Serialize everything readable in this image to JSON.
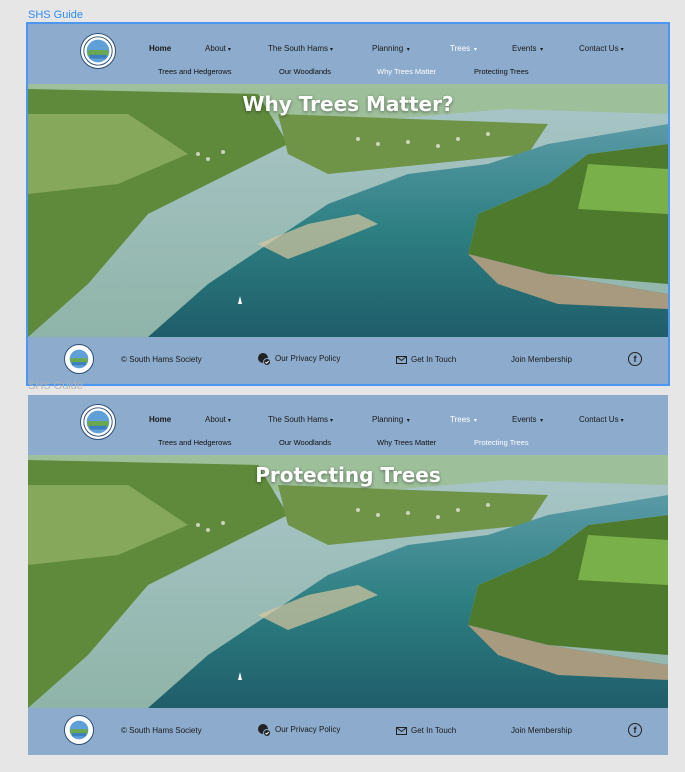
{
  "frames": [
    {
      "label": "SHS Guide",
      "hero_title": "Why Trees Matter?",
      "active_sub": "Why Trees Matter"
    },
    {
      "label": "SHS Guide",
      "hero_title": "Protecting Trees",
      "active_sub": "Protecting Trees"
    }
  ],
  "nav": {
    "home": "Home",
    "about": "About",
    "south_hams": "The South Hams",
    "planning": "Planning",
    "trees": "Trees",
    "events": "Events",
    "contact": "Contact Us"
  },
  "subnav": {
    "trees_hedgerows": "Trees and Hedgerows",
    "woodlands": "Our Woodlands",
    "why_trees": "Why Trees Matter",
    "protecting": "Protecting Trees"
  },
  "footer": {
    "society": "© South Hams Society",
    "privacy": "Our Privacy Policy",
    "touch": "Get In Touch",
    "membership": "Join Membership",
    "facebook": "f"
  },
  "colors": {
    "header_bg": "#8cabcd",
    "selection": "#4b97f2",
    "canvas": "#e6e6e6"
  }
}
